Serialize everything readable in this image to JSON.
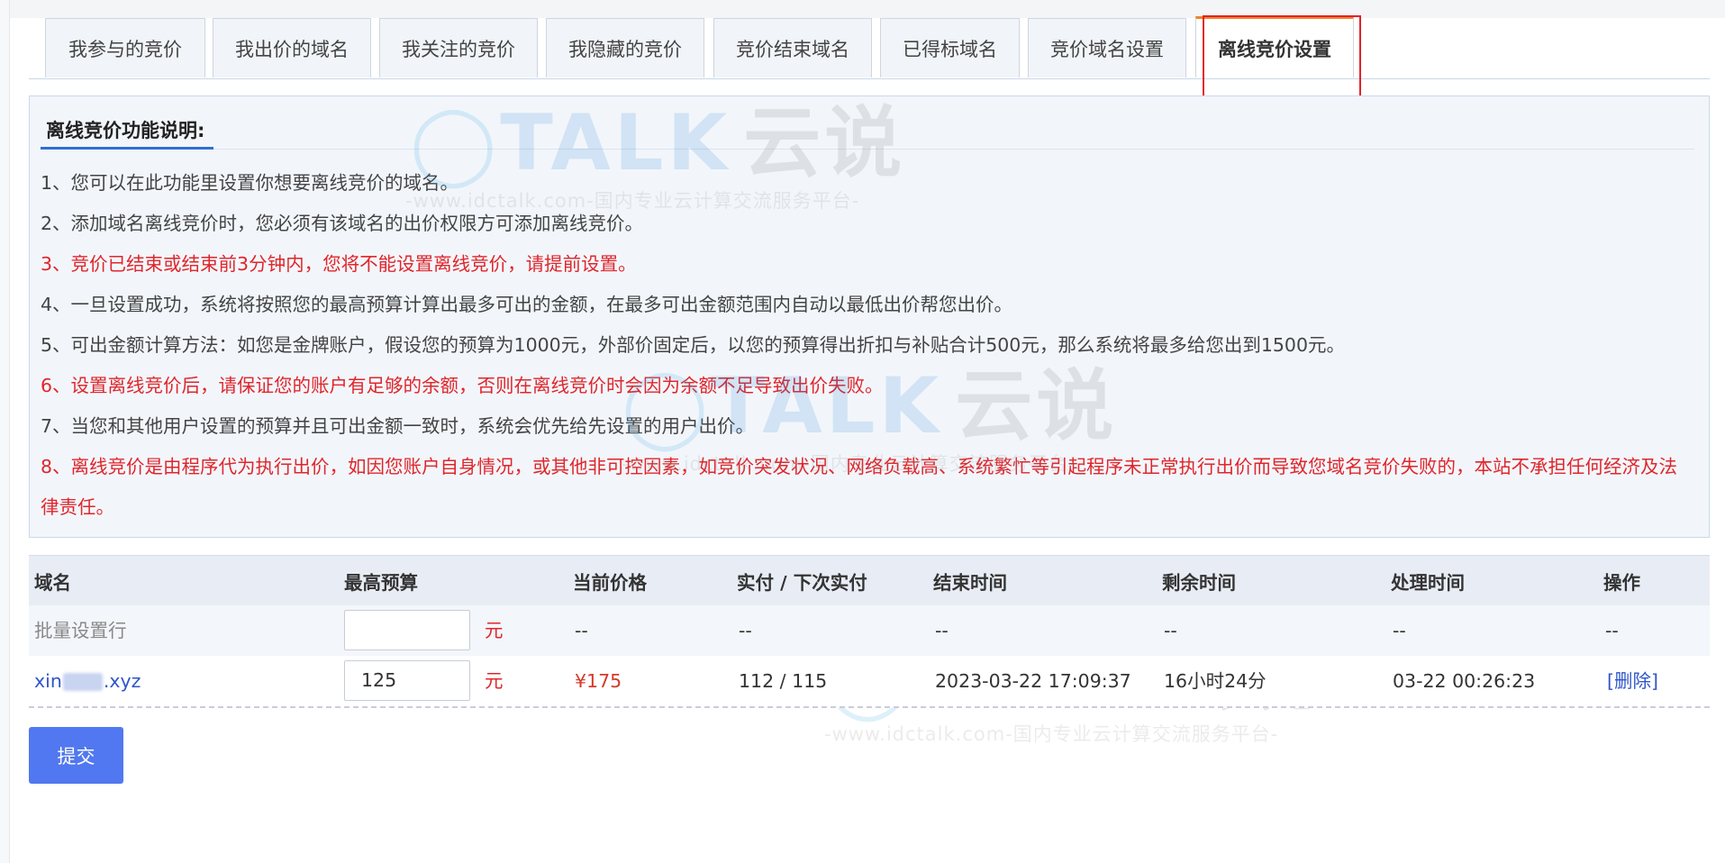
{
  "tabs": [
    {
      "label": "我参与的竞价"
    },
    {
      "label": "我出价的域名"
    },
    {
      "label": "我关注的竞价"
    },
    {
      "label": "我隐藏的竞价"
    },
    {
      "label": "竞价结束域名"
    },
    {
      "label": "已得标域名"
    },
    {
      "label": "竞价域名设置"
    },
    {
      "label": "离线竞价设置",
      "active": true
    }
  ],
  "info": {
    "title": "离线竞价功能说明:",
    "notes": [
      {
        "text": "1、您可以在此功能里设置你想要离线竞价的域名。",
        "color": "normal"
      },
      {
        "text": "2、添加域名离线竞价时，您必须有该域名的出价权限方可添加离线竞价。",
        "color": "normal"
      },
      {
        "text": "3、竞价已结束或结束前3分钟内，您将不能设置离线竞价，请提前设置。",
        "color": "red"
      },
      {
        "text": "4、一旦设置成功，系统将按照您的最高预算计算出最多可出的金额，在最多可出金额范围内自动以最低出价帮您出价。",
        "color": "normal"
      },
      {
        "text": "5、可出金额计算方法：如您是金牌账户，假设您的预算为1000元，外部价固定后，以您的预算得出折扣与补贴合计500元，那么系统将最多给您出到1500元。",
        "color": "normal"
      },
      {
        "text": "6、设置离线竞价后，请保证您的账户有足够的余额，否则在离线竞价时会因为余额不足导致出价失败。",
        "color": "red"
      },
      {
        "text": "7、当您和其他用户设置的预算并且可出金额一致时，系统会优先给先设置的用户出价。",
        "color": "normal"
      },
      {
        "text": "8、离线竞价是由程序代为执行出价，如因您账户自身情况，或其他非可控因素，如竞价突发状况、网络负载高、系统繁忙等引起程序未正常执行出价而导致您域名竞价失败的，本站不承担任何经济及法律责任。",
        "color": "red"
      }
    ]
  },
  "watermark": {
    "brand": "TALK",
    "brand_cn": "云说",
    "url_text": "-www.idctalk.com-国内专业云计算交流服务平台-"
  },
  "table": {
    "headers": {
      "domain": "域名",
      "budget": "最高预算",
      "current_price": "当前价格",
      "paid": "实付 / 下次实付",
      "end_time": "结束时间",
      "remaining": "剩余时间",
      "processed": "处理时间",
      "action": "操作"
    },
    "batch_row": {
      "label": "批量设置行",
      "budget": "",
      "unit": "元",
      "current_price": "--",
      "paid": "--",
      "end_time": "--",
      "remaining": "--",
      "processed": "--",
      "action": "--"
    },
    "rows": [
      {
        "domain_prefix": "xin",
        "domain_suffix": ".xyz",
        "budget": "125",
        "unit": "元",
        "current_price": "¥175",
        "paid": "112 / 115",
        "end_time": "2023-03-22 17:09:37",
        "remaining": "16小时24分",
        "processed": "03-22 00:26:23",
        "action": "[删除]"
      }
    ]
  },
  "submit_label": "提交",
  "colors": {
    "accent": "#5178f0",
    "warning_red": "#e0262b",
    "link_blue": "#2f55c9",
    "tab_active_top": "#f0832a",
    "highlight_box": "#e2222a"
  }
}
